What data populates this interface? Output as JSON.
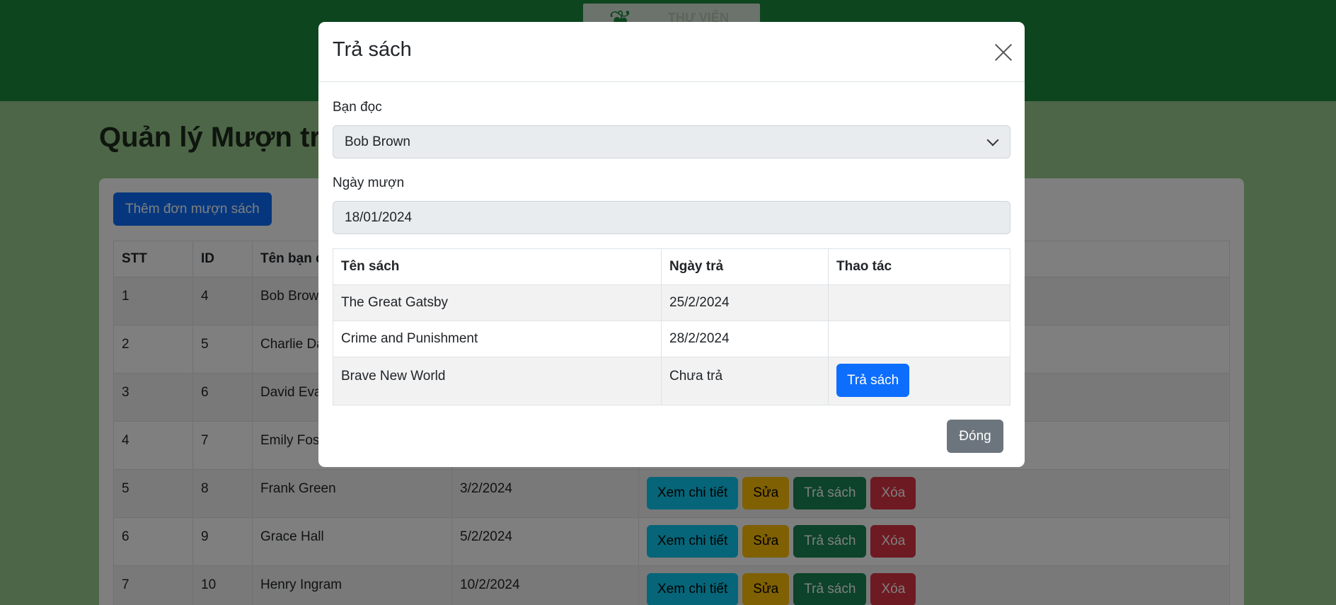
{
  "header": {
    "logo_text": "THƯ VIỆN"
  },
  "page": {
    "title": "Quản lý Mượn trả",
    "add_button": "Thêm đơn mượn sách",
    "columns": [
      "STT",
      "ID",
      "Tên bạn đọc",
      "",
      ""
    ],
    "rows": [
      {
        "stt": "1",
        "id": "4",
        "name": "Bob Brown",
        "date": ""
      },
      {
        "stt": "2",
        "id": "5",
        "name": "Charlie Davis",
        "date": ""
      },
      {
        "stt": "3",
        "id": "6",
        "name": "David Evans",
        "date": ""
      },
      {
        "stt": "4",
        "id": "7",
        "name": "Emily Foster",
        "date": ""
      },
      {
        "stt": "5",
        "id": "8",
        "name": "Frank Green",
        "date": "3/2/2024"
      },
      {
        "stt": "6",
        "id": "9",
        "name": "Grace Hall",
        "date": "5/2/2024"
      },
      {
        "stt": "7",
        "id": "10",
        "name": "Henry Ingram",
        "date": "10/2/2024"
      }
    ],
    "actions": {
      "view": "Xem chi tiết",
      "edit": "Sửa",
      "return": "Trả sách",
      "delete": "Xóa"
    }
  },
  "modal": {
    "title": "Trả sách",
    "reader_label": "Bạn đọc",
    "reader_value": "Bob Brown",
    "borrow_date_label": "Ngày mượn",
    "borrow_date_value": "18/01/2024",
    "columns": [
      "Tên sách",
      "Ngày trả",
      "Thao tác"
    ],
    "books": [
      {
        "title": "The Great Gatsby",
        "return_date": "25/2/2024",
        "action": ""
      },
      {
        "title": "Crime and Punishment",
        "return_date": "28/2/2024",
        "action": ""
      },
      {
        "title": "Brave New World",
        "return_date": "Chưa trả",
        "action": "Trả sách"
      }
    ],
    "close_button": "Đóng"
  },
  "colors": {
    "header_green": "#1a8a3c",
    "primary": "#0d6efd",
    "secondary": "#6c757d",
    "info": "#0dcaf0",
    "warning": "#ffc107",
    "success": "#198754",
    "danger": "#dc3545"
  }
}
